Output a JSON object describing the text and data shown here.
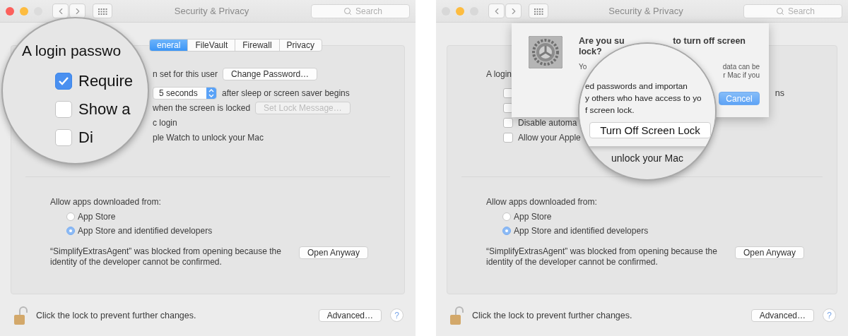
{
  "windows": [
    {
      "kind": "zoomed",
      "title": "Security & Privacy",
      "traffic_lights": [
        {
          "color": "#fc605c"
        },
        {
          "color": "#fdbc40"
        },
        {
          "color": "#dcdcdc"
        }
      ],
      "search": {
        "placeholder": "Search"
      },
      "tabs": [
        {
          "label": "eneral",
          "selected": true
        },
        {
          "label": "FileVault",
          "selected": false
        },
        {
          "label": "Firewall",
          "selected": false
        },
        {
          "label": "Privacy",
          "selected": false
        }
      ],
      "rows": [
        {
          "text": "n set for this user",
          "button": {
            "label": "Change Password…",
            "disabled": false
          }
        },
        {
          "popup": "5 seconds",
          "text": "after sleep or screen saver begins"
        },
        {
          "text": "when the screen is locked",
          "button": {
            "label": "Set Lock Message…",
            "disabled": true
          }
        },
        {
          "text": "c login"
        },
        {
          "text": "ple Watch to unlock your Mac"
        }
      ],
      "gatekeeper": {
        "heading": "Allow apps downloaded from:",
        "options": [
          {
            "label": "App Store",
            "selected": false
          },
          {
            "label": "App Store and identified developers",
            "selected": true
          }
        ],
        "blocked_message": "“SimplifyExtrasAgent” was blocked from opening because the identity of the developer cannot be confirmed.",
        "open_button": "Open Anyway"
      },
      "footer": {
        "lock_text": "Click the lock to prevent further changes.",
        "advanced": "Advanced…",
        "help": "?"
      },
      "magnifier": {
        "kind": "settings",
        "heading": "A login passwo",
        "checkboxes": [
          {
            "label": "Require",
            "checked": true
          },
          {
            "label": "Show a",
            "checked": false
          },
          {
            "label": "Di",
            "checked": false
          }
        ]
      }
    },
    {
      "kind": "dialog",
      "title": "Security & Privacy",
      "traffic_lights": [
        {
          "color": "#d8d8d8"
        },
        {
          "color": "#fdbc40"
        },
        {
          "color": "#d8d8d8"
        }
      ],
      "search": {
        "placeholder": "Search"
      },
      "rows": [
        {
          "text": "A login"
        },
        {
          "checkbox": {
            "checked": false
          },
          "trailing": "ns"
        },
        {
          "checkbox": {
            "checked": false
          }
        },
        {
          "checkbox": {
            "checked": false
          },
          "text": "Disable automa"
        },
        {
          "checkbox": {
            "checked": false
          },
          "text": "Allow your Apple"
        }
      ],
      "gatekeeper": {
        "heading": "Allow apps downloaded from:",
        "options": [
          {
            "label": "App Store",
            "selected": false
          },
          {
            "label": "App Store and identified developers",
            "selected": true
          }
        ],
        "blocked_message": "“SimplifyExtrasAgent” was blocked from opening because the identity of the developer cannot be confirmed.",
        "open_button": "Open Anyway"
      },
      "footer": {
        "lock_text": "Click the lock to prevent further changes.",
        "advanced": "Advanced…",
        "help": "?"
      },
      "dialog": {
        "title_lines": [
          {
            "left": "Are you su",
            "right": "to turn off screen"
          },
          {
            "left": "lock?"
          }
        ],
        "message_lines": [
          {
            "left": "Yo",
            "right": "data can be"
          },
          {
            "right": "r Mac if you"
          }
        ],
        "buttons": [
          {
            "label": "Cancel",
            "default": true
          }
        ]
      },
      "magnifier": {
        "kind": "dialog",
        "lines": [
          "ed passwords and importan",
          "y others who have access to yo",
          "f screen lock."
        ],
        "button": "Turn Off Screen Lock",
        "below": "unlock your Mac"
      }
    }
  ]
}
